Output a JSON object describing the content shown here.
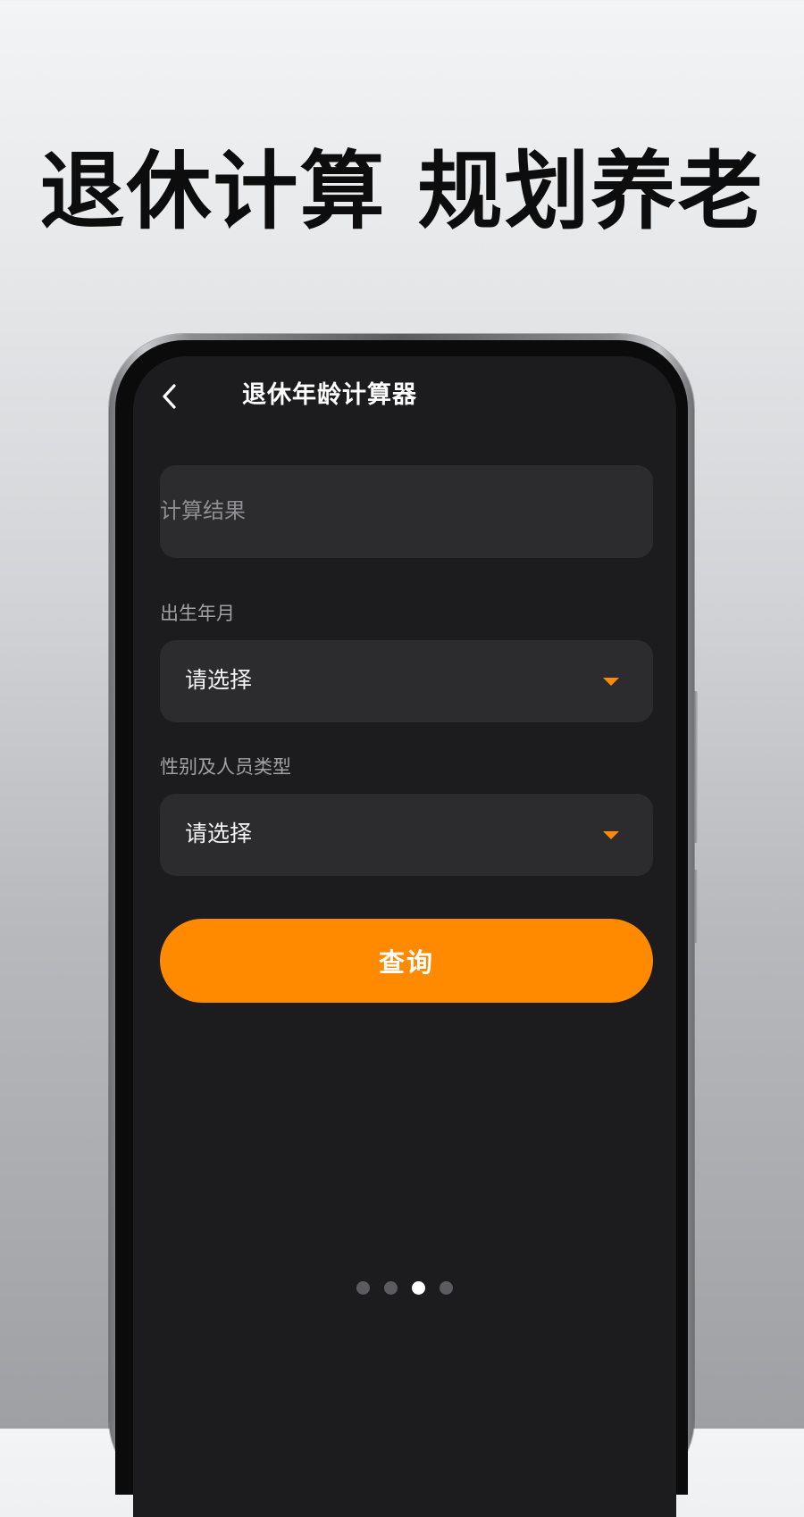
{
  "headline": "退休计算 规划养老",
  "app": {
    "title": "退休年龄计算器",
    "back_icon": "chevron-left-icon"
  },
  "result": {
    "label": "计算结果"
  },
  "birth": {
    "label": "出生年月",
    "value": "请选择"
  },
  "gender_type": {
    "label": "性别及人员类型",
    "value": "请选择"
  },
  "query_button": {
    "label": "查询"
  },
  "pagination": {
    "total": 4,
    "active_index": 2
  },
  "colors": {
    "accent": "#ff8a00",
    "screen_bg": "#1c1c1e",
    "field_bg": "#2c2c2e"
  }
}
